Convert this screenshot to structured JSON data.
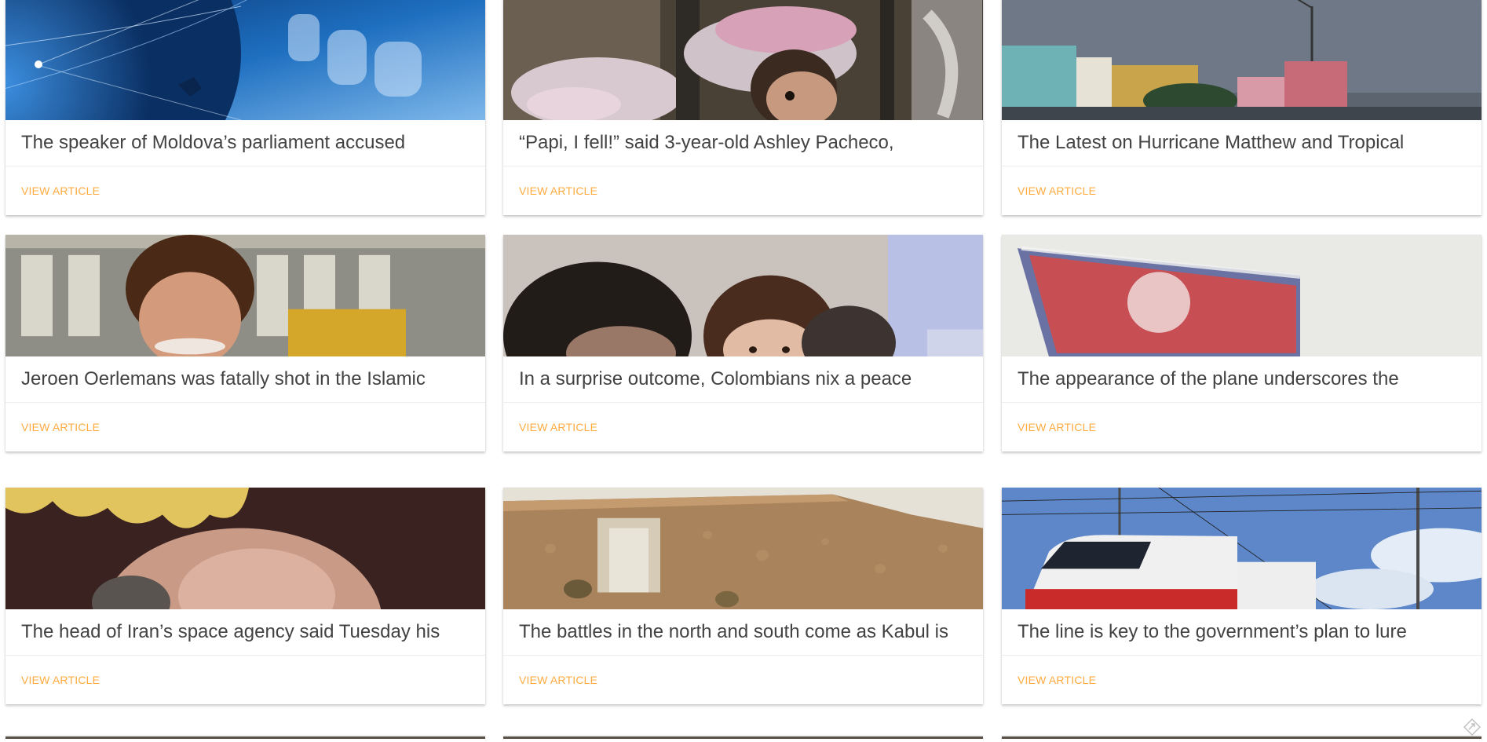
{
  "articles": [
    {
      "title": "The speaker of Moldova’s parliament accused",
      "action": "VIEW ARTICLE",
      "image": "globe-technology-image"
    },
    {
      "title": "“Papi, I fell!” said 3-year-old Ashley Pacheco,",
      "action": "VIEW ARTICLE",
      "image": "child-in-bed-image"
    },
    {
      "title": "The Latest on Hurricane Matthew and Tropical",
      "action": "VIEW ARTICLE",
      "image": "coastal-city-image"
    },
    {
      "title": "Jeroen Oerlemans was fatally shot in the Islamic",
      "action": "VIEW ARTICLE",
      "image": "journalist-portrait-image"
    },
    {
      "title": "In a surprise outcome, Colombians nix a peace",
      "action": "VIEW ARTICLE",
      "image": "crowd-faces-image"
    },
    {
      "title": "The appearance of the plane underscores the",
      "action": "VIEW ARTICLE",
      "image": "flag-image"
    },
    {
      "title": "The head of Iran’s space agency said Tuesday his",
      "action": "VIEW ARTICLE",
      "image": "bald-head-image"
    },
    {
      "title": "The battles in the north and south come as Kabul is",
      "action": "VIEW ARTICLE",
      "image": "mud-wall-soldiers-image"
    },
    {
      "title": "The line is key to the government’s plan to lure",
      "action": "VIEW ARTICLE",
      "image": "train-image"
    }
  ],
  "accent_color": "#ffab40",
  "corner_icon": "diamond-arrow-icon"
}
